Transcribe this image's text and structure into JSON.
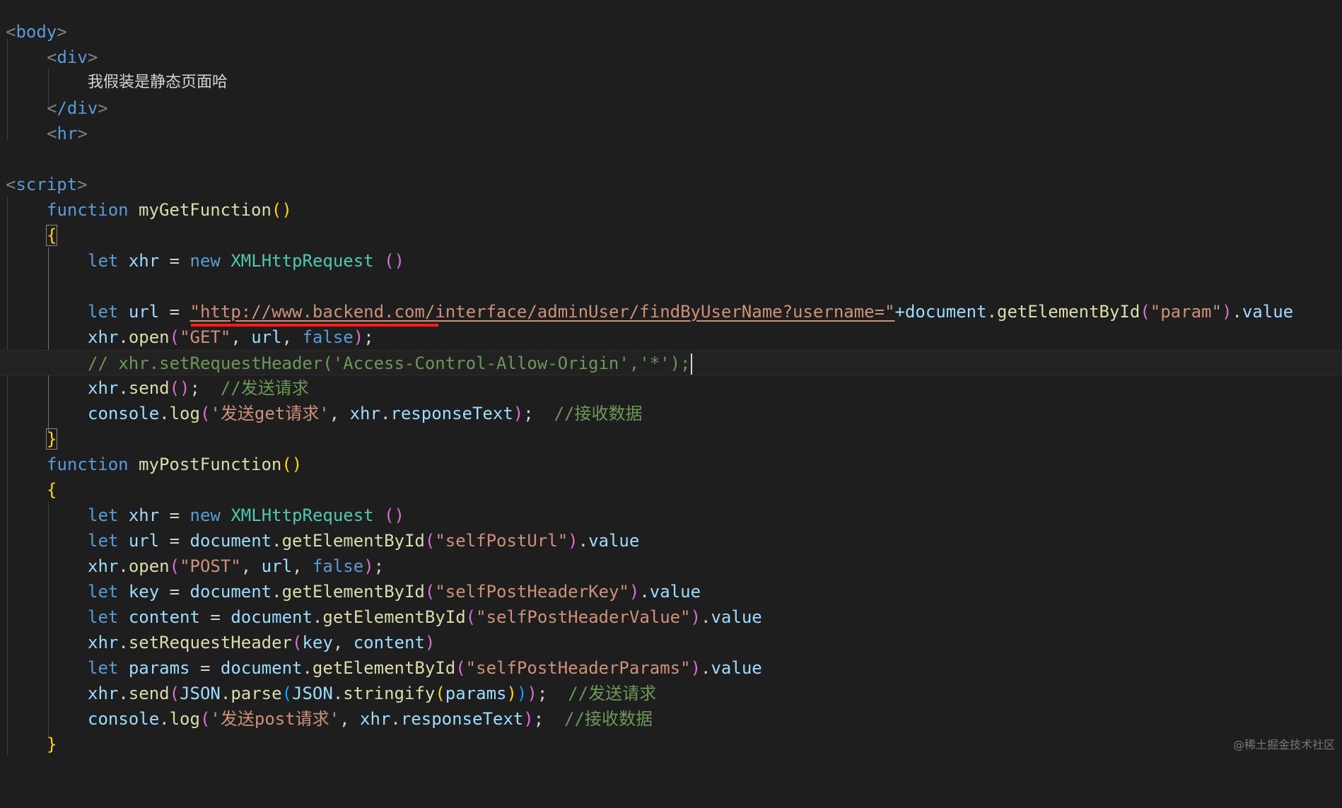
{
  "lines": {
    "body_open": "body",
    "div_open": "div",
    "div_text": "我假装是静态页面哈",
    "div_close": "/div",
    "hr": "hr",
    "script_open": "script",
    "get_fn_kw": "function",
    "get_fn_name": "myGetFunction",
    "kw_let": "let",
    "kw_new": "new",
    "var_xhr": "xhr",
    "var_url": "url",
    "cls_xhr": "XMLHttpRequest",
    "url_string": "\"http://www.backend.com/interface/adminUser/findByUserName?username=\"",
    "plus_doc": "+document",
    "get_el": "getElementById",
    "param_str": "\"param\"",
    "value": "value",
    "open": "open",
    "get_str": "\"GET\"",
    "false_kw": "false",
    "comment_header": "// xhr.setRequestHeader('Access-Control-Allow-Origin','*');",
    "send": "send",
    "comment_send": "//发送请求",
    "console": "console",
    "log": "log",
    "log_get_str": "'发送get请求'",
    "response": "responseText",
    "comment_recv": "//接收数据",
    "post_fn_name": "myPostFunction",
    "document": "document",
    "self_post_url": "\"selfPostUrl\"",
    "post_str": "\"POST\"",
    "var_key": "key",
    "self_post_key": "\"selfPostHeaderKey\"",
    "var_content": "content",
    "self_post_value": "\"selfPostHeaderValue\"",
    "set_header": "setRequestHeader",
    "var_params": "params",
    "self_post_params": "\"selfPostHeaderParams\"",
    "json": "JSON",
    "parse": "parse",
    "stringify": "stringify",
    "log_post_str": "'发送post请求'"
  },
  "watermark": "@稀土掘金技术社区",
  "colors": {
    "background": "#1e1e1e",
    "keyword": "#569cd6",
    "string": "#ce9178",
    "comment": "#6a9955",
    "function": "#dcdcaa",
    "variable": "#9cdcfe",
    "class": "#4ec9b0",
    "annotation_red": "#ff1a1a"
  }
}
